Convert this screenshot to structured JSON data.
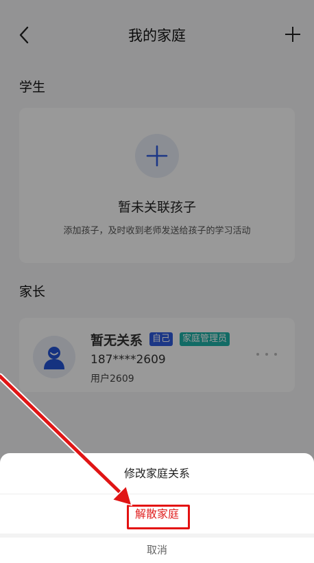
{
  "header": {
    "title": "我的家庭"
  },
  "students": {
    "label": "学生",
    "empty_title": "暂未关联孩子",
    "empty_desc": "添加孩子，及时收到老师发送给孩子的学习活动"
  },
  "parents": {
    "label": "家长",
    "member": {
      "name": "暂无关系",
      "badge_self": "自己",
      "badge_admin": "家庭管理员",
      "phone": "187****2609",
      "username": "用户2609"
    }
  },
  "action_sheet": {
    "modify": "修改家庭关系",
    "dissolve": "解散家庭",
    "cancel": "取消"
  },
  "colors": {
    "danger": "#e02020",
    "badge_self": "#2f5ce0",
    "badge_admin": "#1fb3a8",
    "highlight": "#e31010"
  },
  "icons": {
    "back": "chevron-left-icon",
    "add": "plus-icon",
    "add_child": "plus-icon",
    "avatar": "user-avatar-icon",
    "more": "more-dots-icon"
  }
}
